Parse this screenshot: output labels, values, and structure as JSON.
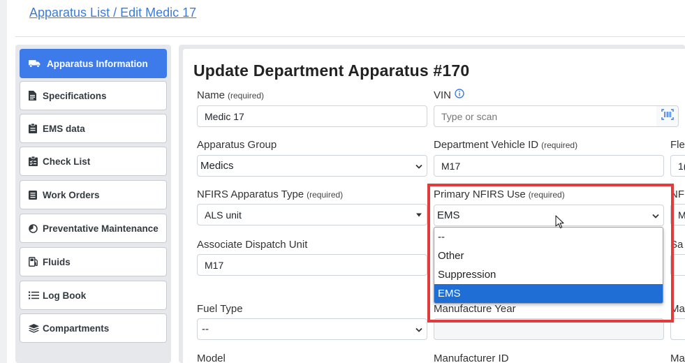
{
  "breadcrumb": "Apparatus List / Edit Medic 17",
  "sidebar": {
    "items": [
      {
        "label": "Apparatus Information",
        "icon": "truck-icon",
        "active": true
      },
      {
        "label": "Specifications",
        "icon": "document-icon"
      },
      {
        "label": "EMS data",
        "icon": "clipboard-icon"
      },
      {
        "label": "Check List",
        "icon": "clipboard-check-icon"
      },
      {
        "label": "Work Orders",
        "icon": "list-box-icon"
      },
      {
        "label": "Preventative Maintenance",
        "icon": "gauge-icon"
      },
      {
        "label": "Fluids",
        "icon": "fuel-pump-icon"
      },
      {
        "label": "Log Book",
        "icon": "list-icon"
      },
      {
        "label": "Compartments",
        "icon": "layers-icon"
      }
    ]
  },
  "form": {
    "title": "Update Department Apparatus #170",
    "required_tag": "(required)",
    "name": {
      "label": "Name",
      "value": "Medic 17"
    },
    "vin": {
      "label": "VIN",
      "placeholder": "Type or scan"
    },
    "apparatus_group": {
      "label": "Apparatus Group",
      "value": "Medics"
    },
    "department_vehicle_id": {
      "label": "Department Vehicle ID",
      "value": "M17"
    },
    "fleet_partial": {
      "label": "Fle",
      "value": "1("
    },
    "nfirs_apparatus_type": {
      "label": "NFIRS Apparatus Type",
      "value": "ALS unit"
    },
    "primary_nfirs_use": {
      "label": "Primary NFIRS Use",
      "value": "EMS",
      "options": [
        "--",
        "Other",
        "Suppression",
        "EMS"
      ],
      "selected_index": 3
    },
    "nf_partial": {
      "label": "NF",
      "value": "M"
    },
    "associate_dispatch_unit": {
      "label": "Associate Dispatch Unit",
      "value": "M17"
    },
    "sa_partial": {
      "label": "Sa"
    },
    "fuel_type": {
      "label": "Fuel Type",
      "value": "--"
    },
    "manufacture_year": {
      "label": "Manufacture Year",
      "value": ""
    },
    "ma_partial": {
      "label": "Ma"
    },
    "model": {
      "label": "Model"
    },
    "manufacturer_id": {
      "label": "Manufacturer ID"
    },
    "ma2_partial": {
      "label": "Ma"
    }
  },
  "colors": {
    "accent": "#3d7bea",
    "link": "#3d7bd9",
    "highlight": "#e23b3b",
    "option_selected": "#1e6ed6"
  }
}
